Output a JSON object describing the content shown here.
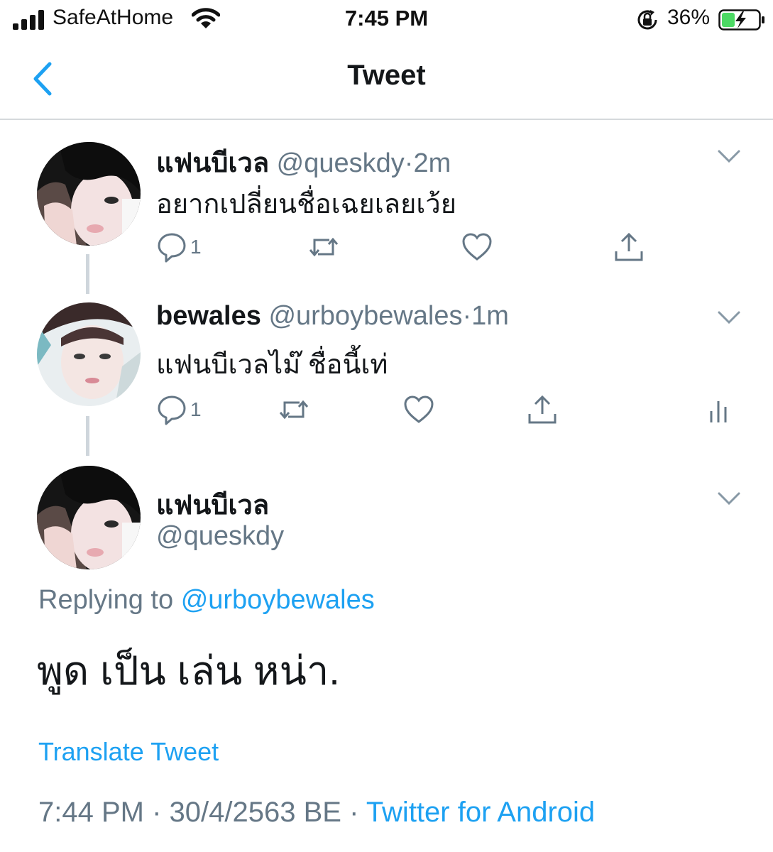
{
  "status_bar": {
    "carrier": "SafeAtHome",
    "time": "7:45 PM",
    "battery_percent": "36%",
    "battery_level": 0.36,
    "icons": [
      "signal-bars-icon",
      "wifi-icon",
      "orientation-lock-icon",
      "battery-charging-icon"
    ]
  },
  "nav": {
    "title": "Tweet",
    "back_icon": "chevron-left-icon"
  },
  "thread": [
    {
      "name": "แฟนบีเวล",
      "handle": "@queskdy",
      "sep": "·",
      "time": "2m",
      "text": "อยากเปลี่ยนชื่อเฉยเลยเว้ย",
      "reply_count": "1"
    },
    {
      "name": "bewales",
      "handle": "@urboybewales",
      "sep": "·",
      "time": "1m",
      "text": "แฟนบีเวลไม๊ ชื่อนี้เท่",
      "reply_count": "1"
    }
  ],
  "main_tweet": {
    "name": "แฟนบีเวล",
    "handle": "@queskdy",
    "replying_prefix": "Replying to",
    "replying_handle": "@urboybewales",
    "text": "พูด เป็น เล่น หน่า.",
    "translate": "Translate Tweet",
    "time": "7:44 PM",
    "dot1": "·",
    "date": "30/4/2563 BE",
    "dot2": "·",
    "source": "Twitter for Android"
  },
  "colors": {
    "accent": "#1da1f2",
    "secondary_text": "#657786",
    "primary_text": "#14171a",
    "battery_green": "#4cd964",
    "divider": "#d5d9dc"
  }
}
